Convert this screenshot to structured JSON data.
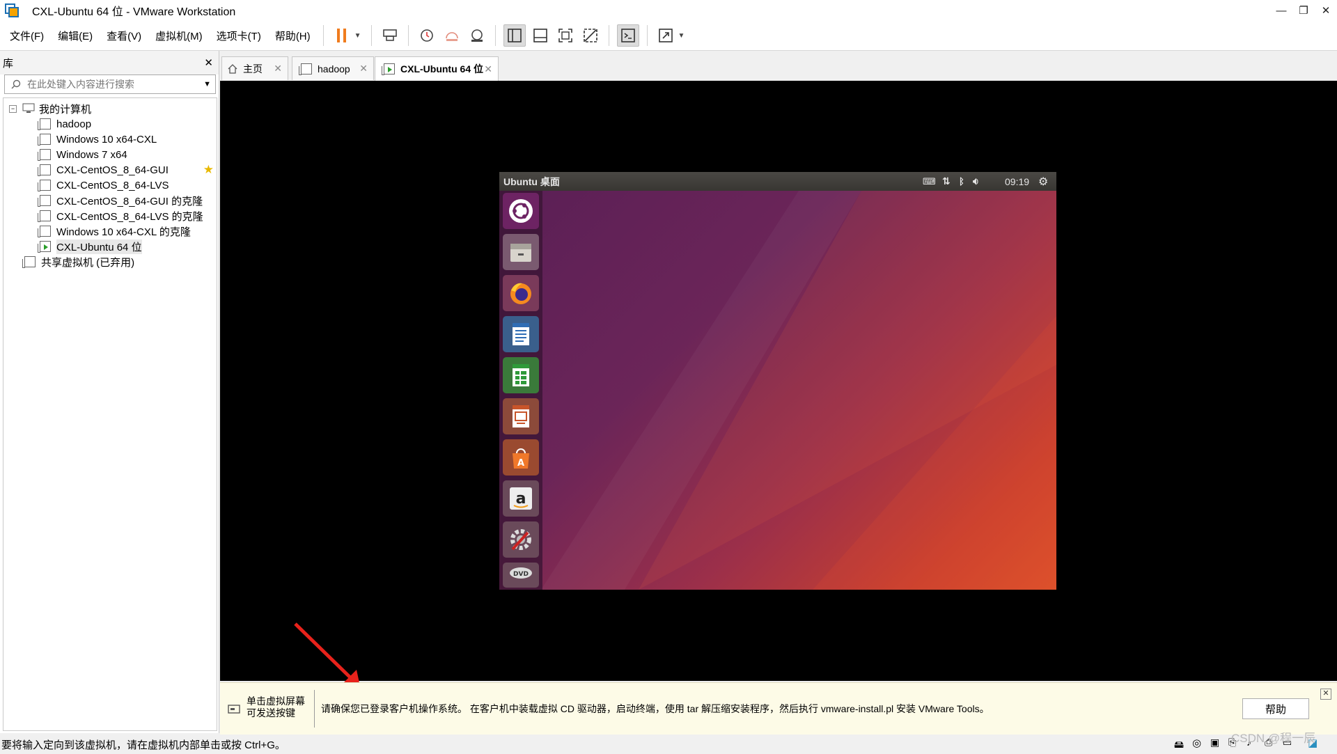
{
  "window": {
    "title": "CXL-Ubuntu 64 位 - VMware Workstation"
  },
  "menu": [
    "文件(F)",
    "编辑(E)",
    "查看(V)",
    "虚拟机(M)",
    "选项卡(T)",
    "帮助(H)"
  ],
  "library": {
    "title": "库",
    "search_placeholder": "在此处键入内容进行搜索",
    "root": "我的计算机",
    "items": [
      "hadoop",
      "Windows 10 x64-CXL",
      "Windows 7 x64",
      "CXL-CentOS_8_64-GUI",
      "CXL-CentOS_8_64-LVS",
      "CXL-CentOS_8_64-GUI 的克隆",
      "CXL-CentOS_8_64-LVS 的克隆",
      "Windows 10 x64-CXL 的克隆",
      "CXL-Ubuntu 64 位"
    ],
    "shared": "共享虚拟机 (已弃用)"
  },
  "tabs": [
    "主页",
    "hadoop",
    "CXL-Ubuntu 64 位"
  ],
  "ubuntu": {
    "title": "Ubuntu 桌面",
    "clock": "09:19",
    "launcher": [
      "dash-icon",
      "files-icon",
      "firefox-icon",
      "writer-icon",
      "calc-icon",
      "impress-icon",
      "software-center-icon",
      "amazon-icon",
      "system-settings-icon",
      "dvd-icon"
    ]
  },
  "infobar": {
    "hint_line1": "单击虚拟屏幕",
    "hint_line2": "可发送按键",
    "message": "请确保您已登录客户机操作系统。 在客户机中装载虚拟 CD 驱动器，启动终端，使用 tar 解压缩安装程序，然后执行 vmware-install.pl 安装 VMware Tools。",
    "help": "帮助"
  },
  "status": {
    "text": "要将输入定向到该虚拟机，请在虚拟机内部单击或按 Ctrl+G。"
  },
  "watermark": "CSDN @程一辰",
  "colors": {
    "accent_pause": "#f07c1e",
    "vm_running": "#2a9d2a",
    "ubuntu_purple": "#5a1f56",
    "ubuntu_orange": "#d9502c",
    "infobar_bg": "#fdfbe7",
    "arrow_red": "#e8221b"
  }
}
